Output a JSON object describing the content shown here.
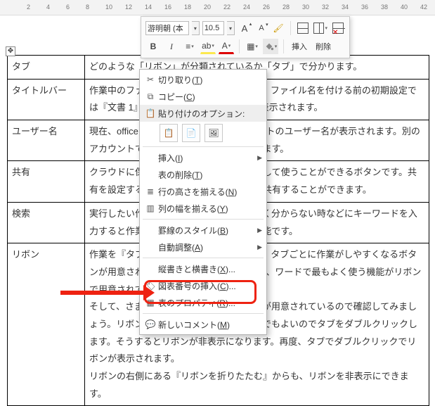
{
  "ruler_marks": [
    2,
    4,
    6,
    8,
    10,
    12,
    14,
    16,
    18,
    20,
    22,
    24,
    26,
    28,
    30,
    32,
    34,
    36,
    38,
    40,
    42
  ],
  "mini_toolbar": {
    "font_name": "游明朝 (本",
    "font_size": "10.5",
    "insert_label": "挿入",
    "delete_label": "削除"
  },
  "table": [
    {
      "label": "タブ",
      "text": "どのような「リボン」が分類されているか「タブ」で分かります。"
    },
    {
      "label": "タイトルバー",
      "text": "作業中のファイル名が表示されるバーです。ファイル名を付ける前の初期設定では『文書 1』や『文書 2』といったように表示されます。"
    },
    {
      "label": "ユーザー名",
      "text": "現在、officeにサインインしているアカウントのユーザー名が表示されます。別のアカウントでサインインし直すこともできます。"
    },
    {
      "label": "共有",
      "text": "クラウドに保存したファイルを仲間と共有して使うことができるボタンです。共有を設定すると同じファイルを複数の人と共有することができます。"
    },
    {
      "label": "検索",
      "text": "実行したい作業を入力すると、やり方がよく分からない時などにキーワードを入力すると作業の実行方法を示してくれる機能です。"
    },
    {
      "label": "リボン",
      "text": "作業を『タブ』ごとに分けることによって、タブごとに作業がしやすくなるボタンが用意されています。『ホームタブ』には、ワードで最もよく使う機能がリボンで用意されています。\nそして、さまざまな『タブ』に『リボン』が用意されているので確認してみましょう。リボンを非表示にする場合は、どこでもよいのでタブをダブルクリックします。そうするとリボンが非表示になります。再度、タブでダブルクリックでリボンが表示されます。\nリボンの右側にある『リボンを折りたたむ』からも、リボンを非表示にできます。"
    }
  ],
  "context_menu": {
    "cut": "切り取り(T)",
    "copy": "コピー(C)",
    "paste_header": "貼り付けのオプション:",
    "insert": "挿入(I)",
    "delete_tbl": "表の削除(T)",
    "row_height": "行の高さを揃える(N)",
    "col_width": "列の幅を揃える(Y)",
    "border_style": "罫線のスタイル(B)",
    "autofit": "自動調整(A)",
    "text_dir": "縦書きと横書き(X)...",
    "caption": "図表番号の挿入(C)...",
    "properties": "表のプロパティ(R)...",
    "new_comment": "新しいコメント(M)"
  }
}
